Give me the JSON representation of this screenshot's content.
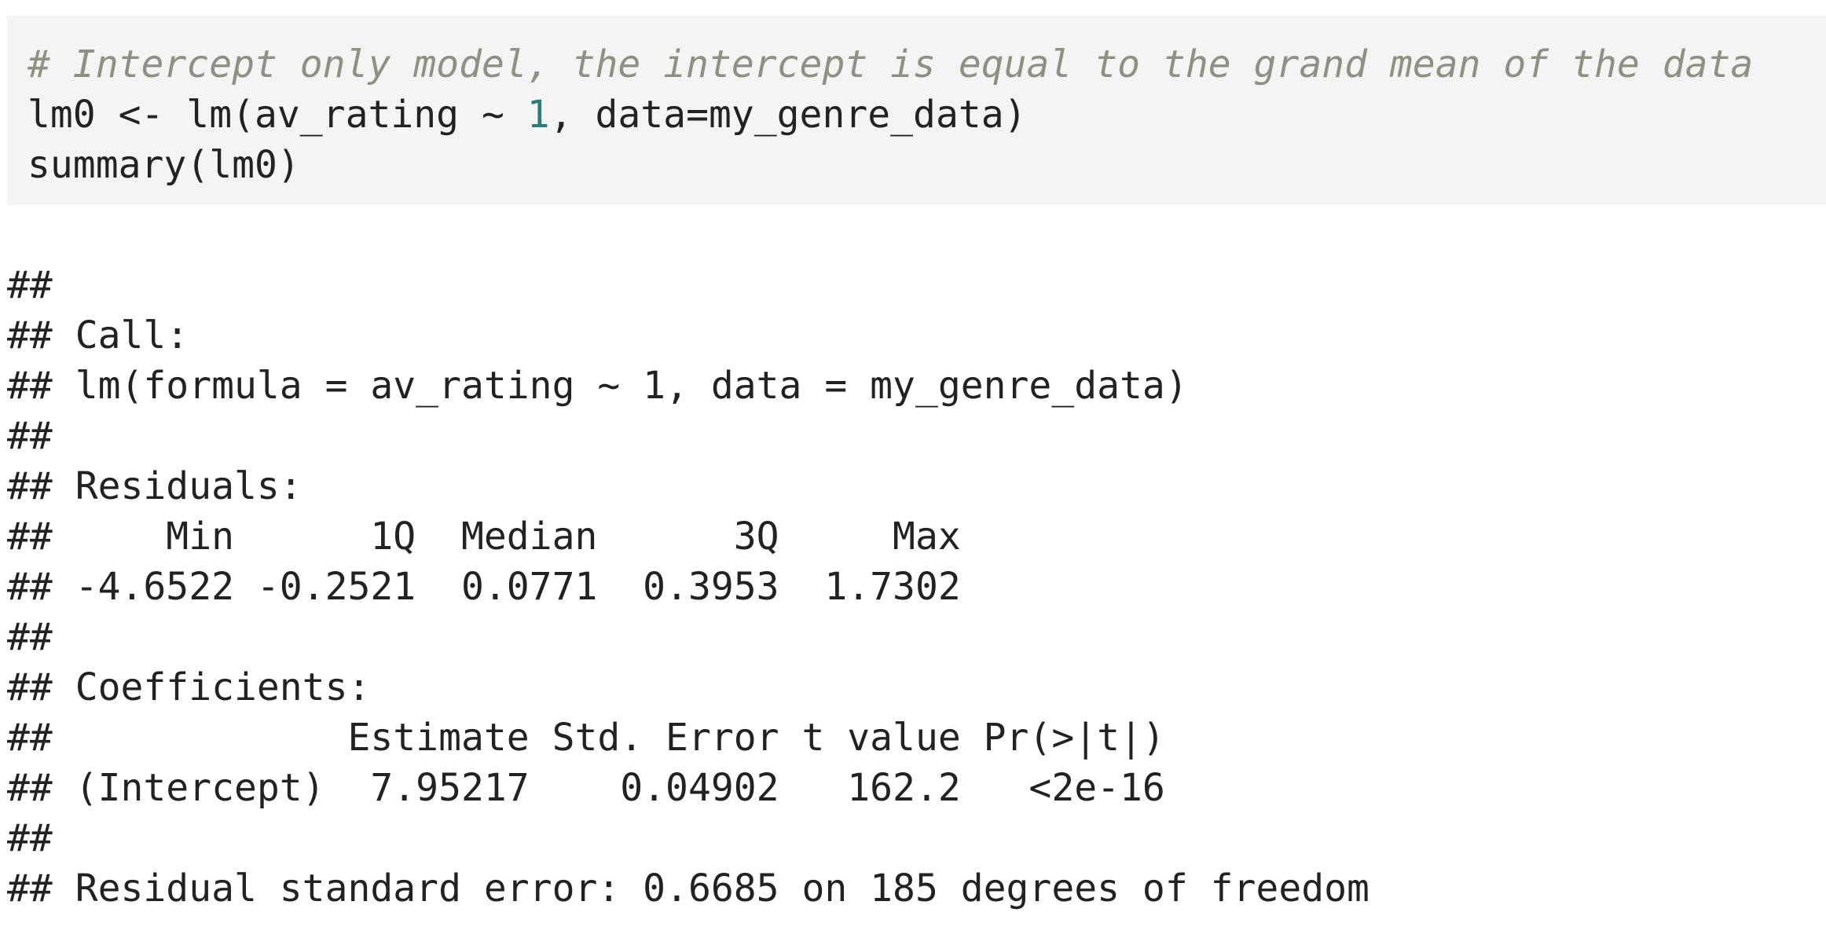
{
  "code": {
    "comment": "# Intercept only model, the intercept is equal to the grand mean of the data",
    "line2_pre": "lm0 <- lm(av_rating ~ ",
    "line2_num": "1",
    "line2_post": ", data=my_genre_data)",
    "line3": "summary(lm0)"
  },
  "output": {
    "lines": [
      "##",
      "## Call:",
      "## lm(formula = av_rating ~ 1, data = my_genre_data)",
      "##",
      "## Residuals:",
      "##     Min      1Q  Median      3Q     Max",
      "## -4.6522 -0.2521  0.0771  0.3953  1.7302",
      "##",
      "## Coefficients:",
      "##             Estimate Std. Error t value Pr(>|t|)",
      "## (Intercept)  7.95217    0.04902   162.2   <2e-16",
      "##",
      "## Residual standard error: 0.6685 on 185 degrees of freedom"
    ]
  },
  "colors": {
    "code_background": "#f4f4f4",
    "comment": "#8f8f82",
    "number_literal": "#2e7a7a",
    "text": "#222222"
  }
}
